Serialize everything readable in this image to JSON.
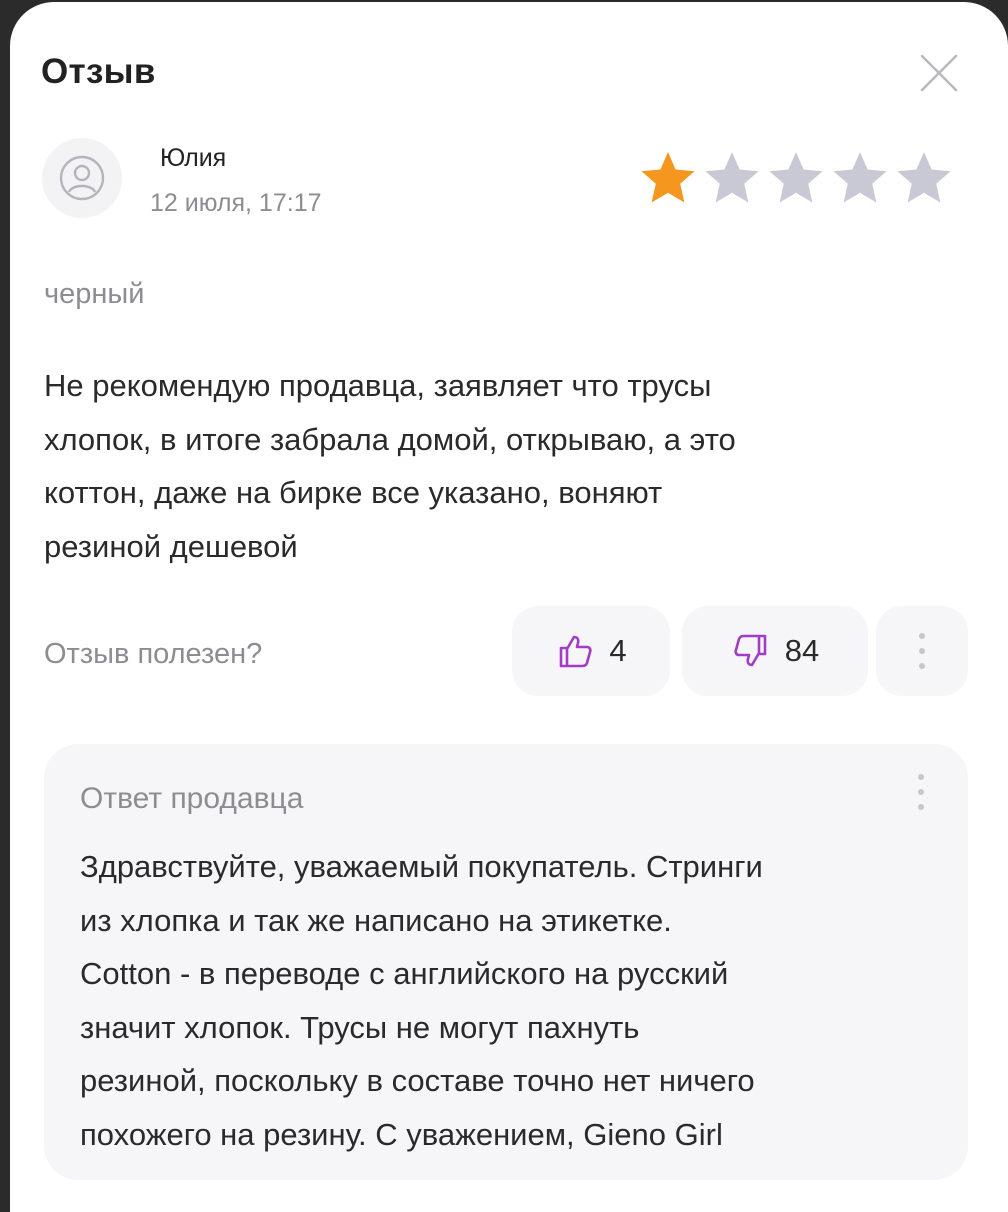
{
  "modal": {
    "title": "Отзыв"
  },
  "review": {
    "author": "Юлия",
    "date": "12 июля, 17:17",
    "rating": 1,
    "rating_max": 5,
    "variant": "черный",
    "text": "Не рекомендую продавца, заявляет что трусы\nхлопок, в итоге забрала  домой, открываю, а это\nкоттон, даже на бирке все указано, воняют\nрезиной дешевой"
  },
  "helpful": {
    "label": "Отзыв полезен?",
    "likes": "4",
    "dislikes": "84"
  },
  "seller_reply": {
    "title": "Ответ продавца",
    "text": "Здравствуйте, уважаемый покупатель. Стринги\nиз хлопка и так же написано на этикетке.\nCotton -  в переводе с английского на русский\nзначит хлопок. Трусы не могут пахнуть\nрезиной, поскольку в составе точно нет ничего\nпохожего на резину. С уважением, Gieno Girl"
  },
  "icons": {
    "close": "close-icon",
    "avatar": "user-icon",
    "like": "thumbs-up-icon",
    "dislike": "thumbs-down-icon",
    "more": "more-vertical-icon",
    "star": "star-icon"
  },
  "colors": {
    "star_active": "#f5961e",
    "star_inactive": "#c9c9d6",
    "accent": "#a23cc8",
    "muted_text": "#8c8c93",
    "panel_bg": "#f6f6f8"
  }
}
